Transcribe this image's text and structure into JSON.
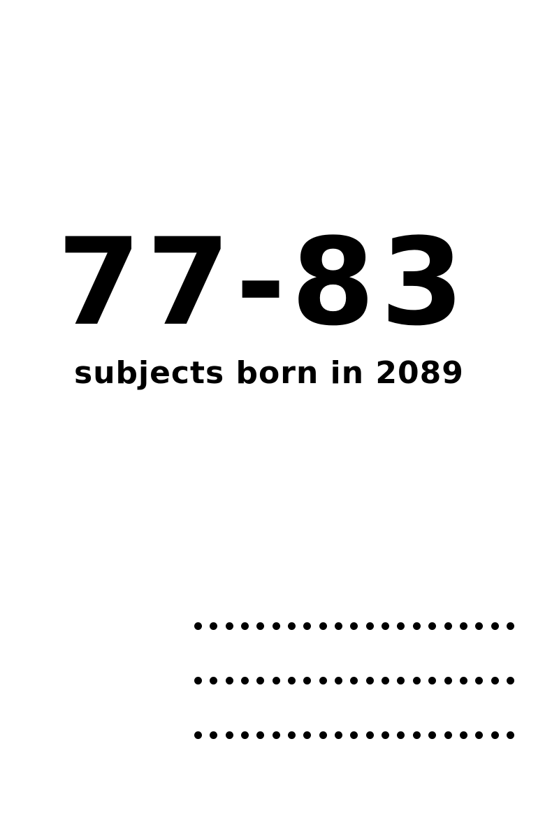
{
  "headline": {
    "value": "77-83"
  },
  "subtitle": {
    "text": "subjects born in 2089"
  },
  "dot_rows": {
    "rows": 3,
    "dots_per_row": 21
  }
}
